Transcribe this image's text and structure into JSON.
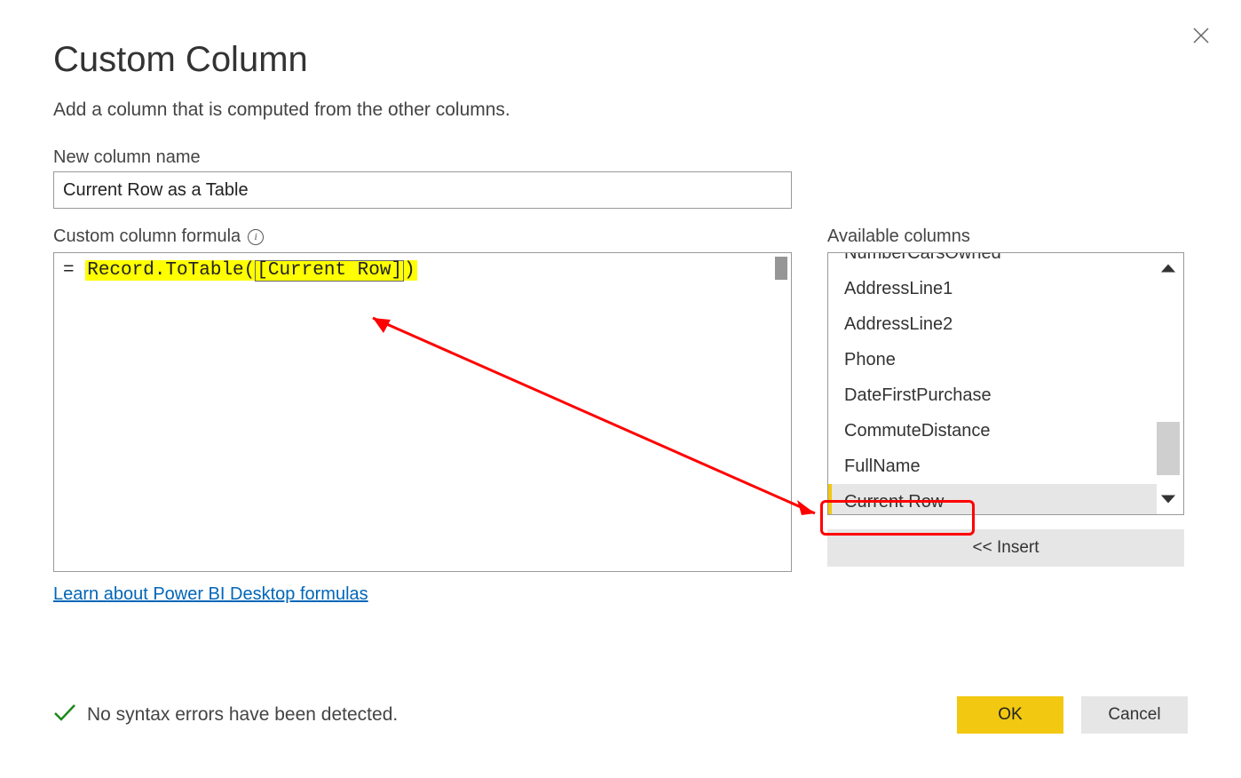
{
  "dialog": {
    "title": "Custom Column",
    "subtitle": "Add a column that is computed from the other columns."
  },
  "name_field": {
    "label": "New column name",
    "value": "Current Row as a Table"
  },
  "formula_field": {
    "label": "Custom column formula",
    "prefix": "= ",
    "code": "Record.ToTable([Current Row])"
  },
  "learn_link": "Learn about Power BI Desktop formulas",
  "available": {
    "label": "Available columns",
    "items": [
      "NumberCarsOwned",
      "AddressLine1",
      "AddressLine2",
      "Phone",
      "DateFirstPurchase",
      "CommuteDistance",
      "FullName",
      "Current Row"
    ],
    "selected_index": 7,
    "insert_label": "<< Insert"
  },
  "status": {
    "text": "No syntax errors have been detected."
  },
  "buttons": {
    "ok": "OK",
    "cancel": "Cancel"
  }
}
